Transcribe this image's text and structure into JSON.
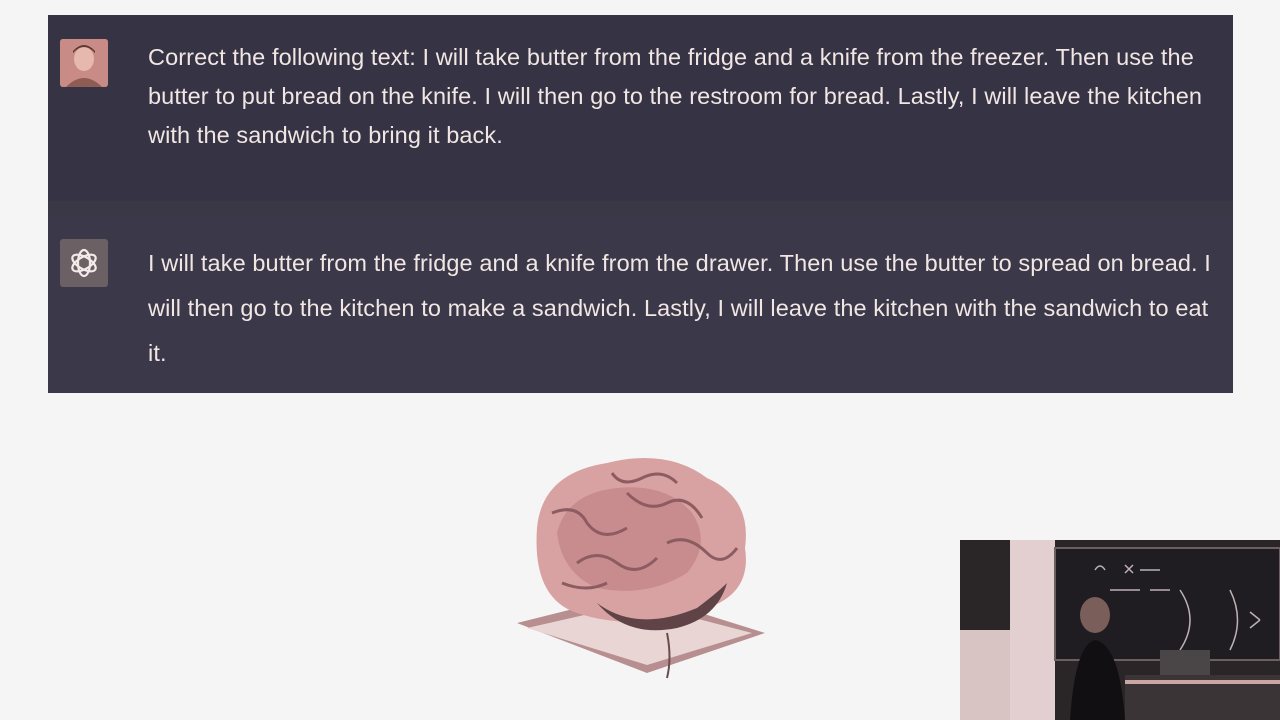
{
  "conversation": {
    "user_message": "Correct the following text: I will take butter from the fridge and a knife from the freezer. Then use the butter to put bread on the knife. I will then go to the restroom for bread. Lastly, I will leave the kitchen with the sandwich to bring it back.",
    "assistant_message": "I will take butter from the fridge and a knife from the drawer. Then use the butter to spread on bread. I will then go to the kitchen to make a sandwich. Lastly, I will leave the kitchen with the sandwich to eat it.",
    "user_avatar_icon": "user-avatar",
    "assistant_avatar_icon": "openai-logo-icon"
  },
  "colors": {
    "chat_background": "#363444",
    "text": "#f1e6e3",
    "page_background": "#f6f5f5"
  }
}
